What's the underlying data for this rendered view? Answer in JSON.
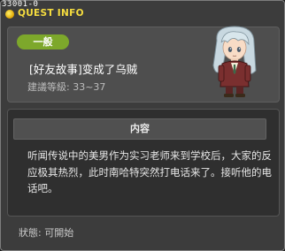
{
  "window": {
    "id_label": "33001-0",
    "title": "QUEST INFO"
  },
  "quest": {
    "category": "一般",
    "title": "[好友故事]变成了乌贼",
    "level": "建議等級: 33~37"
  },
  "content": {
    "header": "内容",
    "text": "听闻传说中的美男作为实习老师来到学校后，大家的反应极其热烈，此时南哈特突然打电话来了。接听他的电话吧。"
  },
  "status": {
    "text": "狀態:  可開始"
  },
  "colors": {
    "title": "#f6dd3f",
    "badge": "#7da82b",
    "npc_hair": "#c8d8e0",
    "npc_coat": "#7a2f2f"
  }
}
